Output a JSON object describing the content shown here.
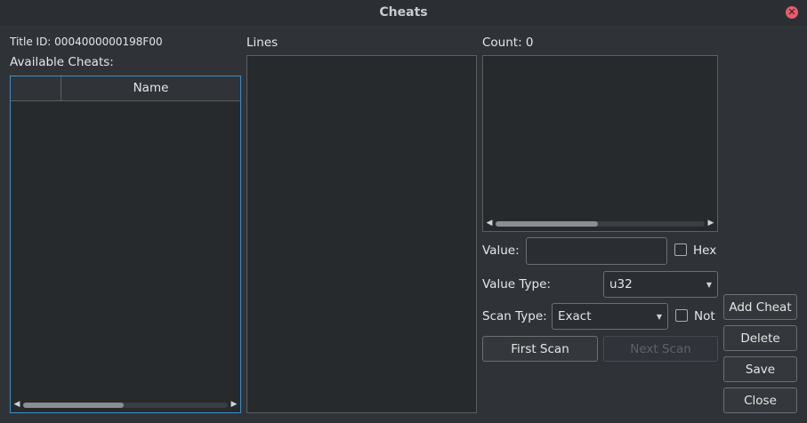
{
  "window": {
    "title": "Cheats"
  },
  "left": {
    "title_id": "Title ID: 0004000000198F00",
    "available_label": "Available Cheats:",
    "table": {
      "columns": [
        "",
        "Name"
      ]
    }
  },
  "middle": {
    "lines_label": "Lines"
  },
  "right": {
    "count_label": "Count: 0",
    "value_label": "Value:",
    "value_input": "",
    "hex_label": "Hex",
    "value_type_label": "Value Type:",
    "value_type": "u32",
    "scan_type_label": "Scan Type:",
    "scan_type": "Exact",
    "not_label": "Not",
    "first_scan": "First Scan",
    "next_scan": "Next Scan"
  },
  "actions": {
    "add_cheat": "Add Cheat",
    "delete": "Delete",
    "save": "Save",
    "close": "Close"
  },
  "icons": {
    "close": "close-icon",
    "scroll_left": "arrow-left-icon",
    "scroll_right": "arrow-right-icon",
    "dropdown": "chevron-down-icon"
  },
  "colors": {
    "background": "#2f3338",
    "panel": "#262a2d",
    "focus_border": "#3d8ec7",
    "close_button": "#e35d6a"
  },
  "scroll": {
    "cheats_table_thumb_fraction": 0.49,
    "results_thumb_fraction": 0.49
  }
}
